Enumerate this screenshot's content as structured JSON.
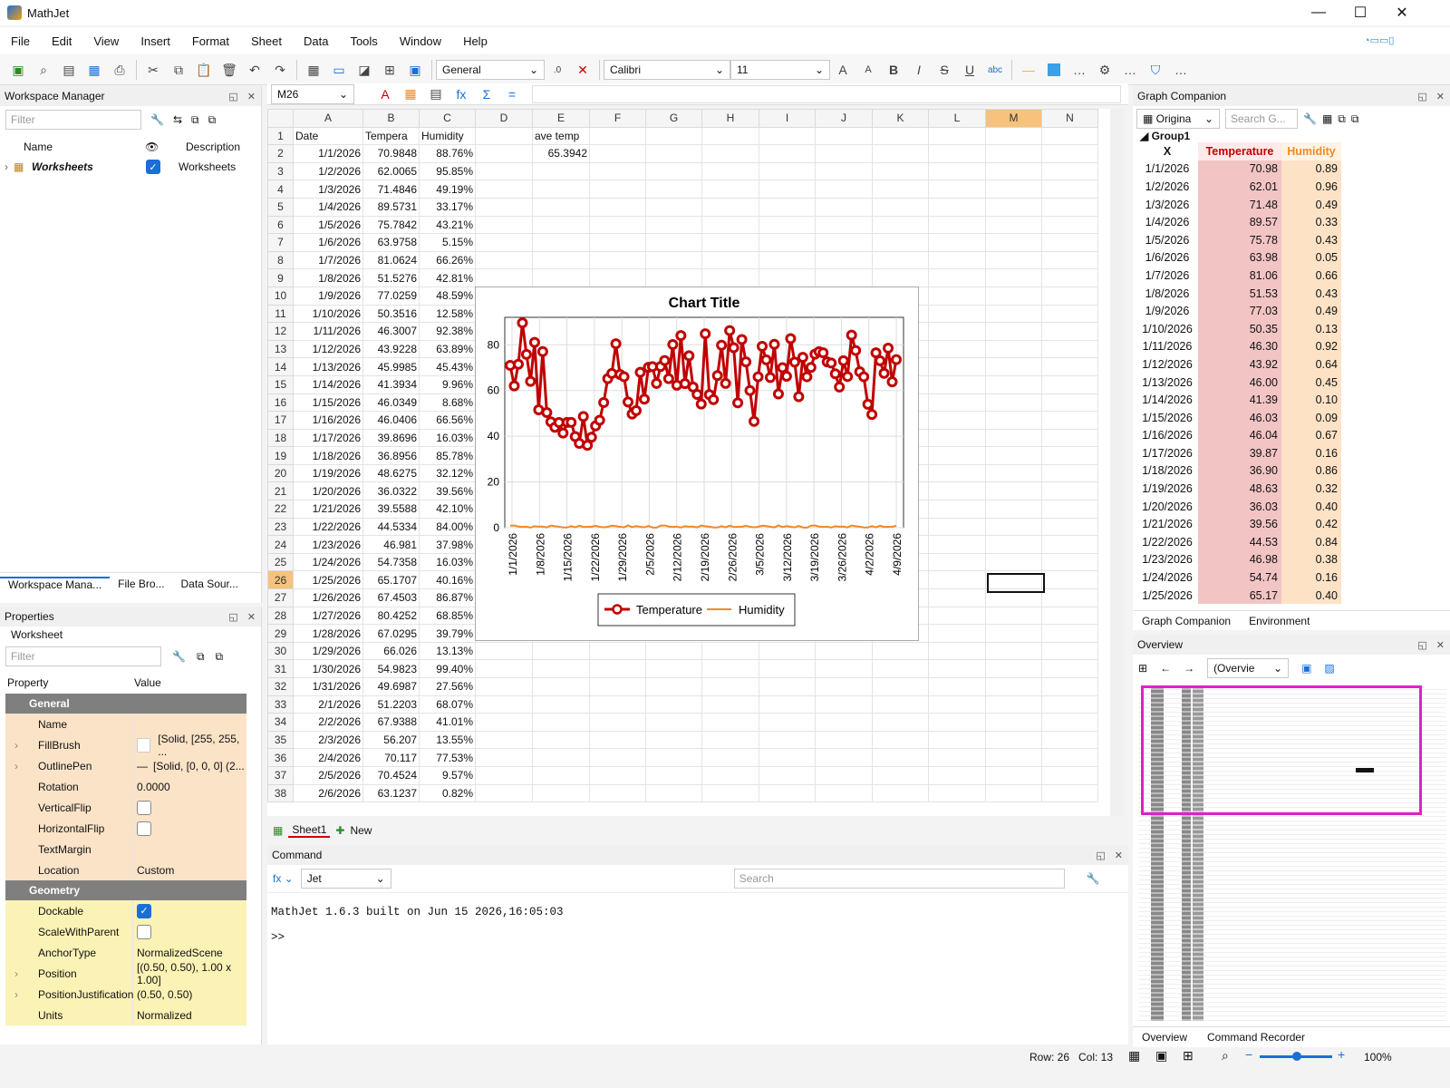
{
  "app": {
    "title": "MathJet"
  },
  "menu": [
    "File",
    "Edit",
    "View",
    "Insert",
    "Format",
    "Sheet",
    "Data",
    "Tools",
    "Window",
    "Help"
  ],
  "toolbar": {
    "number_format": "General",
    "font": "Calibri",
    "size": "11"
  },
  "workspace": {
    "title": "Workspace Manager",
    "filter_placeholder": "Filter",
    "col_name": "Name",
    "col_desc": "Description",
    "item_name": "Worksheets",
    "item_desc": "Worksheets",
    "tabs": [
      "Workspace Mana...",
      "File Bro...",
      "Data Sour..."
    ]
  },
  "properties": {
    "title": "Properties",
    "subtitle": "Worksheet",
    "filter_placeholder": "Filter",
    "col_property": "Property",
    "col_value": "Value",
    "group_general": "General",
    "group_geometry": "Geometry",
    "rows": {
      "name": "Name",
      "fillbrush": "FillBrush",
      "fillbrush_val": "[Solid, [255, 255, ...",
      "outlinepen": "OutlinePen",
      "outlinepen_val": "[Solid, [0, 0, 0] (2...",
      "rotation": "Rotation",
      "rotation_val": "0.0000",
      "vflip": "VerticalFlip",
      "hflip": "HorizontalFlip",
      "textmargin": "TextMargin",
      "location": "Location",
      "location_val": "Custom",
      "dockable": "Dockable",
      "scalewithparent": "ScaleWithParent",
      "anchortype": "AnchorType",
      "anchortype_val": "NormalizedScene",
      "position": "Position",
      "position_val": "[(0.50, 0.50), 1.00 x 1.00]",
      "posjust": "PositionJustification",
      "posjust_val": "(0.50, 0.50)",
      "units": "Units",
      "units_val": "Normalized"
    }
  },
  "formula_bar": {
    "cell_ref": "M26",
    "content": ""
  },
  "sheet": {
    "columns": [
      "A",
      "B",
      "C",
      "D",
      "E",
      "F",
      "G",
      "H",
      "I",
      "J",
      "K",
      "L",
      "M",
      "N"
    ],
    "header_row": [
      "Date",
      "Tempera",
      "Humidity",
      "",
      "ave temp"
    ],
    "ave_value": "65.3942",
    "rows": [
      [
        "1/1/2026",
        "70.9848",
        "88.76%"
      ],
      [
        "1/2/2026",
        "62.0065",
        "95.85%"
      ],
      [
        "1/3/2026",
        "71.4846",
        "49.19%"
      ],
      [
        "1/4/2026",
        "89.5731",
        "33.17%"
      ],
      [
        "1/5/2026",
        "75.7842",
        "43.21%"
      ],
      [
        "1/6/2026",
        "63.9758",
        "5.15%"
      ],
      [
        "1/7/2026",
        "81.0624",
        "66.26%"
      ],
      [
        "1/8/2026",
        "51.5276",
        "42.81%"
      ],
      [
        "1/9/2026",
        "77.0259",
        "48.59%"
      ],
      [
        "1/10/2026",
        "50.3516",
        "12.58%"
      ],
      [
        "1/11/2026",
        "46.3007",
        "92.38%"
      ],
      [
        "1/12/2026",
        "43.9228",
        "63.89%"
      ],
      [
        "1/13/2026",
        "45.9985",
        "45.43%"
      ],
      [
        "1/14/2026",
        "41.3934",
        "9.96%"
      ],
      [
        "1/15/2026",
        "46.0349",
        "8.68%"
      ],
      [
        "1/16/2026",
        "46.0406",
        "66.56%"
      ],
      [
        "1/17/2026",
        "39.8696",
        "16.03%"
      ],
      [
        "1/18/2026",
        "36.8956",
        "85.78%"
      ],
      [
        "1/19/2026",
        "48.6275",
        "32.12%"
      ],
      [
        "1/20/2026",
        "36.0322",
        "39.56%"
      ],
      [
        "1/21/2026",
        "39.5588",
        "42.10%"
      ],
      [
        "1/22/2026",
        "44.5334",
        "84.00%"
      ],
      [
        "1/23/2026",
        "46.981",
        "37.98%"
      ],
      [
        "1/24/2026",
        "54.7358",
        "16.03%"
      ],
      [
        "1/25/2026",
        "65.1707",
        "40.16%"
      ],
      [
        "1/26/2026",
        "67.4503",
        "86.87%"
      ],
      [
        "1/27/2026",
        "80.4252",
        "68.85%"
      ],
      [
        "1/28/2026",
        "67.0295",
        "39.79%"
      ],
      [
        "1/29/2026",
        "66.026",
        "13.13%"
      ],
      [
        "1/30/2026",
        "54.9823",
        "99.40%"
      ],
      [
        "1/31/2026",
        "49.6987",
        "27.56%"
      ],
      [
        "2/1/2026",
        "51.2203",
        "68.07%"
      ],
      [
        "2/2/2026",
        "67.9388",
        "41.01%"
      ],
      [
        "2/3/2026",
        "56.207",
        "13.55%"
      ],
      [
        "2/4/2026",
        "70.117",
        "77.53%"
      ],
      [
        "2/5/2026",
        "70.4524",
        "9.57%"
      ],
      [
        "2/6/2026",
        "63.1237",
        "0.82%"
      ]
    ],
    "tabs": [
      "Sheet1",
      "New"
    ]
  },
  "chart_data": {
    "type": "line",
    "title": "Chart Title",
    "x_ticks": [
      "1/1/2026",
      "1/8/2026",
      "1/15/2026",
      "1/22/2026",
      "1/29/2026",
      "2/5/2026",
      "2/12/2026",
      "2/19/2026",
      "2/26/2026",
      "3/5/2026",
      "3/12/2026",
      "3/19/2026",
      "3/26/2026",
      "4/2/2026",
      "4/9/2026"
    ],
    "y_ticks": [
      "0",
      "20",
      "40",
      "60",
      "80"
    ],
    "ylim": [
      0,
      92
    ],
    "series": [
      {
        "name": "Temperature",
        "color": "#c00000",
        "values": [
          70.98,
          62.01,
          71.48,
          89.57,
          75.78,
          63.98,
          81.06,
          51.53,
          77.03,
          50.35,
          46.3,
          43.92,
          46.0,
          41.39,
          46.03,
          46.04,
          39.87,
          36.9,
          48.63,
          36.03,
          39.56,
          44.53,
          46.98,
          54.74,
          65.17,
          67.45,
          80.43,
          67.03,
          66.03,
          54.98,
          49.7,
          51.22,
          67.94,
          56.21,
          70.12,
          70.45,
          63.12,
          70.5,
          73.1,
          65.2,
          80.1,
          62.3,
          84.0,
          63.0,
          75.2,
          61.5,
          58.3,
          54.1,
          84.8,
          58.2,
          56.0,
          66.5,
          79.8,
          63.1,
          86.2,
          78.7,
          54.6,
          82.3,
          72.5,
          60.0,
          46.5,
          66.0,
          79.3,
          73.4,
          65.7,
          80.2,
          58.5,
          70.0,
          66.2,
          82.7,
          72.4,
          57.3,
          74.5,
          66.0,
          70.1,
          75.9,
          77.0,
          76.5,
          72.5,
          72.0,
          67.3,
          61.5,
          73.0,
          66.1,
          84.2,
          77.5,
          68.2,
          66.0,
          54.0,
          49.5,
          76.5,
          73.0,
          67.5,
          78.5,
          63.8,
          73.5
        ]
      },
      {
        "name": "Humidity",
        "color": "#f08a24",
        "values": [
          0.89,
          0.96,
          0.49,
          0.33,
          0.43,
          0.05,
          0.66,
          0.43,
          0.49,
          0.13,
          0.92,
          0.64,
          0.45,
          0.1,
          0.09,
          0.67,
          0.16,
          0.86,
          0.32,
          0.4,
          0.42,
          0.84,
          0.38,
          0.16,
          0.4,
          0.87,
          0.69,
          0.4,
          0.13,
          0.99,
          0.28,
          0.68,
          0.41,
          0.14,
          0.78,
          0.1,
          0.01
        ]
      }
    ],
    "legend": "bottom"
  },
  "graph_companion": {
    "title": "Graph Companion",
    "source": "Origina",
    "search_placeholder": "Search G...",
    "group": "Group1",
    "headers": [
      "X",
      "Temperature",
      "Humidity"
    ],
    "rows": [
      [
        "1/1/2026",
        "70.98",
        "0.89"
      ],
      [
        "1/2/2026",
        "62.01",
        "0.96"
      ],
      [
        "1/3/2026",
        "71.48",
        "0.49"
      ],
      [
        "1/4/2026",
        "89.57",
        "0.33"
      ],
      [
        "1/5/2026",
        "75.78",
        "0.43"
      ],
      [
        "1/6/2026",
        "63.98",
        "0.05"
      ],
      [
        "1/7/2026",
        "81.06",
        "0.66"
      ],
      [
        "1/8/2026",
        "51.53",
        "0.43"
      ],
      [
        "1/9/2026",
        "77.03",
        "0.49"
      ],
      [
        "1/10/2026",
        "50.35",
        "0.13"
      ],
      [
        "1/11/2026",
        "46.30",
        "0.92"
      ],
      [
        "1/12/2026",
        "43.92",
        "0.64"
      ],
      [
        "1/13/2026",
        "46.00",
        "0.45"
      ],
      [
        "1/14/2026",
        "41.39",
        "0.10"
      ],
      [
        "1/15/2026",
        "46.03",
        "0.09"
      ],
      [
        "1/16/2026",
        "46.04",
        "0.67"
      ],
      [
        "1/17/2026",
        "39.87",
        "0.16"
      ],
      [
        "1/18/2026",
        "36.90",
        "0.86"
      ],
      [
        "1/19/2026",
        "48.63",
        "0.32"
      ],
      [
        "1/20/2026",
        "36.03",
        "0.40"
      ],
      [
        "1/21/2026",
        "39.56",
        "0.42"
      ],
      [
        "1/22/2026",
        "44.53",
        "0.84"
      ],
      [
        "1/23/2026",
        "46.98",
        "0.38"
      ],
      [
        "1/24/2026",
        "54.74",
        "0.16"
      ],
      [
        "1/25/2026",
        "65.17",
        "0.40"
      ]
    ],
    "tabs": [
      "Graph Companion",
      "Environment"
    ]
  },
  "overview": {
    "title": "Overview",
    "combo": "(Overvie",
    "tabs": [
      "Overview",
      "Command Recorder"
    ]
  },
  "command": {
    "title": "Command",
    "engine": "Jet",
    "search_placeholder": "Search",
    "banner": "MathJet 1.6.3 built on Jun 15 2026,16:05:03",
    "prompt": ">>"
  },
  "status": {
    "row": "Row: 26",
    "col": "Col: 13",
    "zoom": "100%"
  },
  "colors": {
    "accent": "#1a6ed8",
    "prop_general": "#fbe3c8",
    "prop_geometry": "#fbf2b5",
    "temp_header": "#c00000",
    "hum_header": "#f08a24",
    "temp_bg": "#f2c4c4",
    "hum_bg": "#fde2c6",
    "overview_frame": "#e020c8"
  }
}
